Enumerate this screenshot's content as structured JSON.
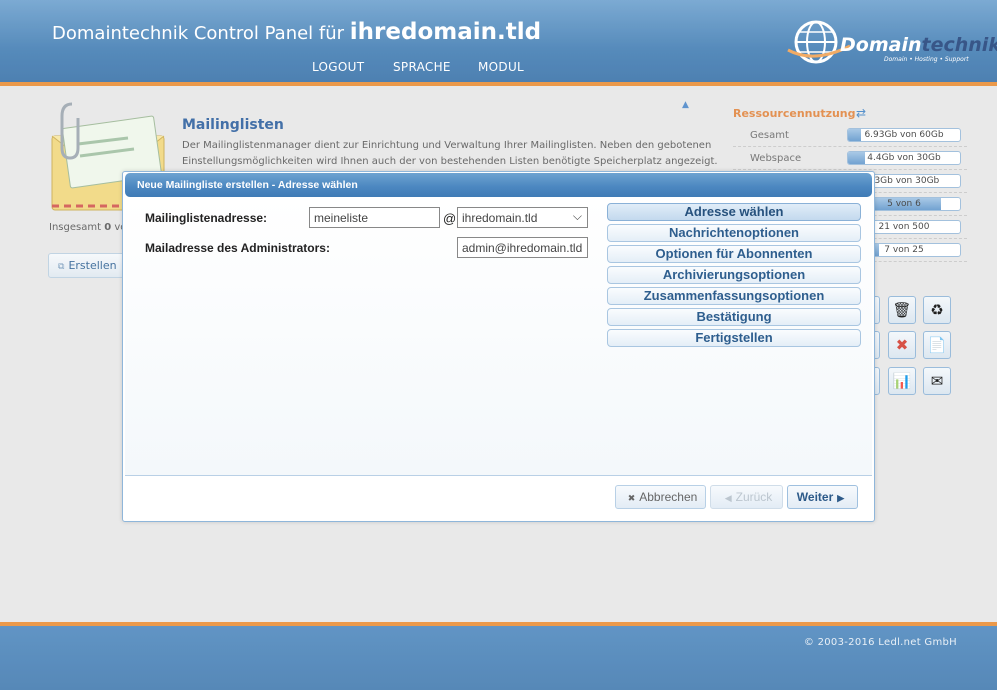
{
  "header": {
    "title_prefix": "Domaintechnik Control Panel für",
    "domain": "ihredomain.tld",
    "nav": [
      {
        "label": "LOGOUT"
      },
      {
        "label": "SPRACHE"
      },
      {
        "label": "MODUL"
      }
    ],
    "logo": {
      "word1": "Domain",
      "word2": "technik",
      "tagline": "Domain • Hosting • Support"
    }
  },
  "module": {
    "title": "Mailinglisten",
    "description": "Der Mailinglistenmanager dient zur Einrichtung und Verwaltung Ihrer Mailinglisten. Neben den gebotenen Einstellungsmöglichkeiten wird Ihnen auch der von bestehenden Listen benötigte Speicherplatz angezeigt.",
    "total_prefix": "Insgesamt",
    "total_count": "0",
    "total_suffix": "vo",
    "create_label": "Erstellen"
  },
  "resources": {
    "title": "Ressourcennutzung",
    "rows": [
      {
        "label": "Gesamt",
        "text": "6.93Gb von 60Gb",
        "fill": 0.12
      },
      {
        "label": "Webspace",
        "text": "4.4Gb von 30Gb",
        "fill": 0.15
      },
      {
        "label": "",
        "text": "53Gb von 30Gb",
        "fill": 0.06
      },
      {
        "label": "",
        "text": "5 von 6",
        "fill": 0.83
      },
      {
        "label": "",
        "text": "21 von 500",
        "fill": 0.04
      },
      {
        "label": "",
        "text": "7 von 25",
        "fill": 0.28
      }
    ]
  },
  "dialog": {
    "title": "Neue Mailingliste erstellen - Adresse wählen",
    "fields": {
      "list_address_label": "Mailinglistenadresse:",
      "list_address_value": "meineliste",
      "at": "@",
      "domain_value": "ihredomain.tld",
      "admin_label": "Mailadresse des Administrators:",
      "admin_value": "admin@ihredomain.tld"
    },
    "steps": [
      {
        "label": "Adresse wählen",
        "active": true
      },
      {
        "label": "Nachrichtenoptionen"
      },
      {
        "label": "Optionen für Abonnenten"
      },
      {
        "label": "Archivierungsoptionen"
      },
      {
        "label": "Zusammenfassungsoptionen"
      },
      {
        "label": "Bestätigung"
      },
      {
        "label": "Fertigstellen"
      }
    ],
    "buttons": {
      "cancel": "Abbrechen",
      "back": "Zurück",
      "next": "Weiter"
    }
  },
  "footer": {
    "copyright": "© 2003-2016 Ledl.net GmbH"
  },
  "colors": {
    "accent_orange": "#e98b32",
    "header_blue": "#3f7bb2",
    "link_blue": "#2a5d9c"
  }
}
